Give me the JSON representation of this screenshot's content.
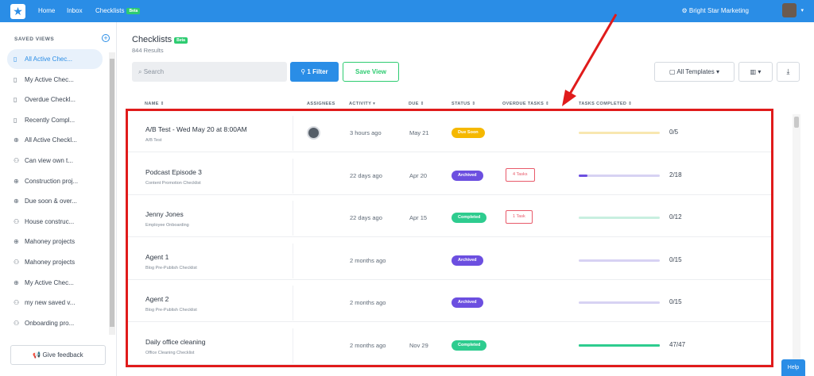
{
  "topbar": {
    "logo_icon": "star-logo-icon",
    "nav": [
      "Home",
      "Inbox",
      "Checklists"
    ],
    "beta": "Beta",
    "org_name": "Bright Star Marketing"
  },
  "sidebar": {
    "title": "SAVED VIEWS",
    "items": [
      {
        "label": "All Active Chec...",
        "icon": "book-icon",
        "active": true
      },
      {
        "label": "My Active Chec...",
        "icon": "book-icon"
      },
      {
        "label": "Overdue Checkl...",
        "icon": "book-icon"
      },
      {
        "label": "Recently Compl...",
        "icon": "book-icon"
      },
      {
        "label": "All Active Checkl...",
        "icon": "globe-icon"
      },
      {
        "label": "Can view own t...",
        "icon": "users-icon"
      },
      {
        "label": "Construction proj...",
        "icon": "globe-icon"
      },
      {
        "label": "Due soon & over...",
        "icon": "globe-icon"
      },
      {
        "label": "House construc...",
        "icon": "users-icon"
      },
      {
        "label": "Mahoney projects",
        "icon": "globe-icon"
      },
      {
        "label": "Mahoney projects",
        "icon": "users-icon"
      },
      {
        "label": "My Active Chec...",
        "icon": "globe-icon"
      },
      {
        "label": "my new saved v...",
        "icon": "users-icon"
      },
      {
        "label": "Onboarding pro...",
        "icon": "users-icon"
      }
    ],
    "feedback": "Give feedback"
  },
  "main": {
    "title": "Checklists",
    "beta": "Beta",
    "results": "844 Results",
    "search_placeholder": "Search",
    "filter_label": "1 Filter",
    "save_view_label": "Save View",
    "templates_label": "All Templates"
  },
  "table": {
    "headers": {
      "name": "NAME",
      "assignees": "ASSIGNEES",
      "activity": "ACTIVITY",
      "due": "DUE",
      "status": "STATUS",
      "overdue": "OVERDUE TASKS",
      "completed": "TASKS COMPLETED"
    },
    "rows": [
      {
        "name": "A/B Test - Wed May 20 at 8:00AM",
        "template": "A/B Test",
        "has_assignee": true,
        "activity": "3 hours ago",
        "due": "May 21",
        "status": "Due Soon",
        "status_color": "#f5b800",
        "overdue": "",
        "completed": "0/5",
        "progress": 0.0,
        "bar_color": "#f8e7b0"
      },
      {
        "name": "Podcast Episode 3",
        "template": "Content Promotion Checklist",
        "has_assignee": false,
        "activity": "22 days ago",
        "due": "Apr 20",
        "status": "Archived",
        "status_color": "#6c4fe0",
        "overdue": "4 Tasks",
        "completed": "2/18",
        "progress": 0.11,
        "bar_color": "#d7d2f3"
      },
      {
        "name": "Jenny Jones",
        "template": "Employee Onboarding",
        "has_assignee": false,
        "activity": "22 days ago",
        "due": "Apr 15",
        "status": "Completed",
        "status_color": "#2ecc8f",
        "overdue": "1 Task",
        "completed": "0/12",
        "progress": 0.0,
        "bar_color": "#c8efe0"
      },
      {
        "name": "Agent 1",
        "template": "Blog Pre-Publish Checklist",
        "has_assignee": false,
        "activity": "2 months ago",
        "due": "",
        "status": "Archived",
        "status_color": "#6c4fe0",
        "overdue": "",
        "completed": "0/15",
        "progress": 0.0,
        "bar_color": "#d7d2f3"
      },
      {
        "name": "Agent 2",
        "template": "Blog Pre-Publish Checklist",
        "has_assignee": false,
        "activity": "2 months ago",
        "due": "",
        "status": "Archived",
        "status_color": "#6c4fe0",
        "overdue": "",
        "completed": "0/15",
        "progress": 0.0,
        "bar_color": "#d7d2f3"
      },
      {
        "name": "Daily office cleaning",
        "template": "Office Cleaning Checklist",
        "has_assignee": false,
        "activity": "2 months ago",
        "due": "Nov 29",
        "status": "Completed",
        "status_color": "#2ecc8f",
        "overdue": "",
        "completed": "47/47",
        "progress": 1.0,
        "bar_color": "#2ecc8f"
      }
    ]
  },
  "help": "Help",
  "colors": {
    "accent": "#2a8de6",
    "success": "#2ecc71",
    "annotation": "#e01b1b"
  }
}
